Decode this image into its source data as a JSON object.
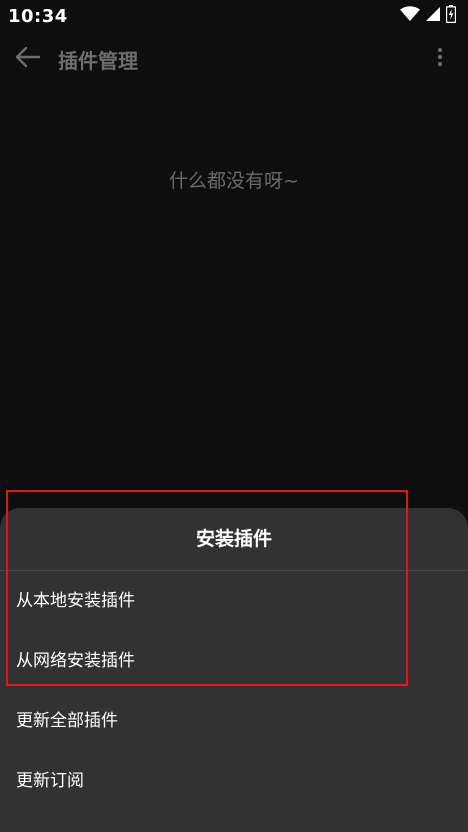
{
  "status_bar": {
    "time": "10:34",
    "icons": [
      "wifi-icon",
      "signal-icon",
      "battery-icon"
    ]
  },
  "toolbar": {
    "back_icon": "arrow-left-icon",
    "title": "插件管理",
    "more_icon": "more-vert-icon"
  },
  "empty_state": {
    "message": "什么都没有呀~"
  },
  "sheet": {
    "title": "安装插件",
    "items": [
      {
        "label": "从本地安装插件"
      },
      {
        "label": "从网络安装插件"
      },
      {
        "label": "更新全部插件"
      },
      {
        "label": "更新订阅"
      }
    ]
  },
  "colors": {
    "background": "#0e0e0e",
    "sheet": "#323232",
    "highlight": "#e0161c",
    "muted_text": "#6e6e6e"
  }
}
